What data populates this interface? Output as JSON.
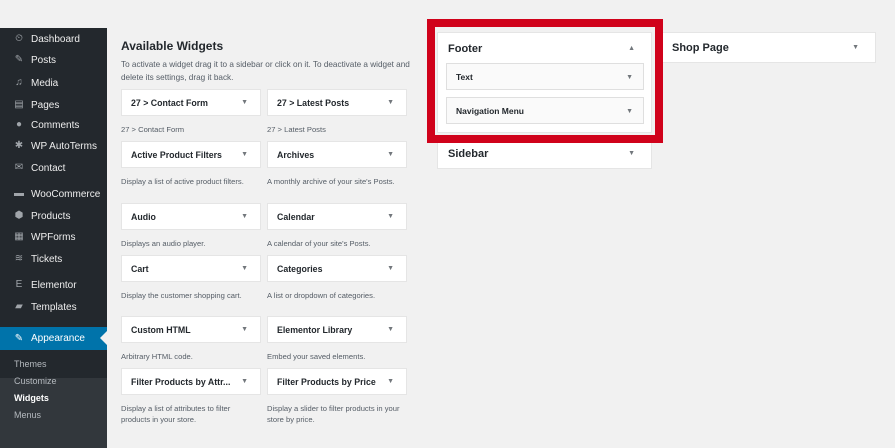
{
  "sidebar": {
    "items": [
      {
        "label": "Dashboard",
        "icon": "dashboard-icon",
        "glyph": "⏲"
      },
      {
        "label": "Posts",
        "icon": "pin-icon",
        "glyph": "✎"
      },
      {
        "label": "Media",
        "icon": "media-icon",
        "glyph": "♫"
      },
      {
        "label": "Pages",
        "icon": "pages-icon",
        "glyph": "▤"
      },
      {
        "label": "Comments",
        "icon": "comments-icon",
        "glyph": "●"
      },
      {
        "label": "WP AutoTerms",
        "icon": "autoterms-icon",
        "glyph": "✱"
      },
      {
        "label": "Contact",
        "icon": "mail-icon",
        "glyph": "✉"
      },
      {
        "label": "WooCommerce",
        "icon": "woo-icon",
        "glyph": "▬"
      },
      {
        "label": "Products",
        "icon": "products-icon",
        "glyph": "⬢"
      },
      {
        "label": "WPForms",
        "icon": "forms-icon",
        "glyph": "▦"
      },
      {
        "label": "Tickets",
        "icon": "tickets-icon",
        "glyph": "≋"
      },
      {
        "label": "Elementor",
        "icon": "elementor-icon",
        "glyph": "E"
      },
      {
        "label": "Templates",
        "icon": "folder-icon",
        "glyph": "▰"
      },
      {
        "label": "Appearance",
        "icon": "brush-icon",
        "glyph": "✎"
      }
    ],
    "submenu": [
      "Themes",
      "Customize",
      "Widgets",
      "Menus"
    ]
  },
  "available": {
    "title": "Available Widgets",
    "description": "To activate a widget drag it to a sidebar or click on it. To deactivate a widget and delete its settings, drag it back."
  },
  "widgets": [
    {
      "name": "27 > Contact Form",
      "desc": "27 > Contact Form"
    },
    {
      "name": "27 > Latest Posts",
      "desc": "27 > Latest Posts"
    },
    {
      "name": "Active Product Filters",
      "desc": "Display a list of active product filters."
    },
    {
      "name": "Archives",
      "desc": "A monthly archive of your site's Posts."
    },
    {
      "name": "Audio",
      "desc": "Displays an audio player."
    },
    {
      "name": "Calendar",
      "desc": "A calendar of your site's Posts."
    },
    {
      "name": "Cart",
      "desc": "Display the customer shopping cart."
    },
    {
      "name": "Categories",
      "desc": "A list or dropdown of categories."
    },
    {
      "name": "Custom HTML",
      "desc": "Arbitrary HTML code."
    },
    {
      "name": "Elementor Library",
      "desc": "Embed your saved elements."
    },
    {
      "name": "Filter Products by Attr...",
      "desc": "Display a list of attributes to filter products in your store."
    },
    {
      "name": "Filter Products by Price",
      "desc": "Display a slider to filter products in your store by price."
    }
  ],
  "areas": {
    "footer": {
      "title": "Footer",
      "items": [
        "Text",
        "Navigation Menu"
      ]
    },
    "sidebar": {
      "title": "Sidebar"
    },
    "shop": {
      "title": "Shop Page"
    }
  },
  "colors": {
    "highlight": "#d0021b",
    "accent": "#0073aa",
    "admin_bg": "#23282d"
  }
}
